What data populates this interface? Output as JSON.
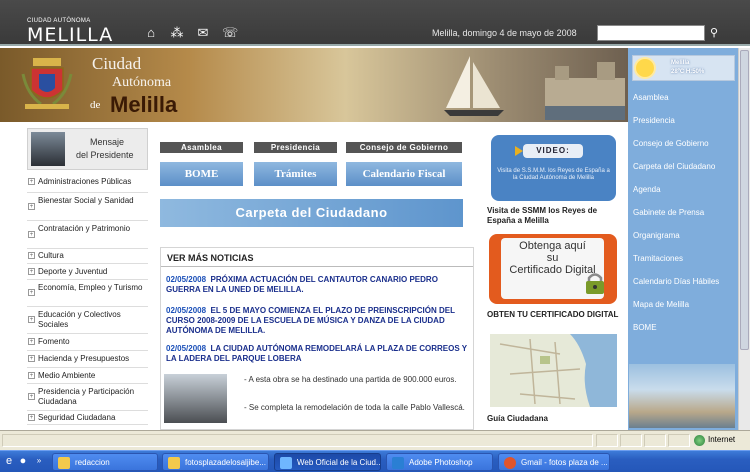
{
  "header": {
    "brand_small": "CIUDAD AUTÓNOMA",
    "brand_big": "MELILLA",
    "icons": [
      "home-icon",
      "sitemap-icon",
      "mail-icon",
      "chat-icon"
    ],
    "date": "Melilla, domingo 4 de mayo de 2008",
    "search_placeholder": ""
  },
  "banner": {
    "line1": "Ciudad",
    "line2": "Autónoma",
    "line3_pre": "de",
    "line3": "Melilla"
  },
  "weather": {
    "city": "Melilla",
    "reading": "28ºC  H:50%"
  },
  "right_menu": [
    "Asamblea",
    "Presidencia",
    "Consejo de Gobierno",
    "Carpeta del Ciudadano",
    "Agenda",
    "Gabinete de Prensa",
    "Organigrama",
    "Tramitaciones",
    "Calendario Días Hábiles",
    "Mapa de Melilla",
    "BOME"
  ],
  "president": {
    "line1": "Mensaje",
    "line2": "del Presidente"
  },
  "left_menu": [
    "Administraciones Públicas",
    "Bienestar Social y Sanidad",
    "Contratación y Patrimonio",
    "Cultura",
    "Deporte y Juventud",
    "Economía, Empleo y Turismo",
    "Educación y Colectivos Sociales",
    "Fomento",
    "Hacienda y Presupuestos",
    "Medio Ambiente",
    "Presidencia y Participación Ciudadana",
    "Seguridad Ciudadana"
  ],
  "tabs": [
    "Asamblea",
    "Presidencia",
    "Consejo de Gobierno"
  ],
  "big_buttons": [
    "BOME",
    "Trámites",
    "Calendario Fiscal"
  ],
  "carpeta": "Carpeta del Ciudadano",
  "news": {
    "header": "VER MÁS NOTICIAS",
    "items": [
      {
        "date": "02/05/2008",
        "title": "PRÓXIMA ACTUACIÓN DEL CANTAUTOR CANARIO PEDRO GUERRA EN LA UNED DE MELILLA."
      },
      {
        "date": "02/05/2008",
        "title": "EL 5 DE MAYO COMIENZA EL PLAZO DE PREINSCRIPCIÓN DEL CURSO 2008-2009 DE LA ESCUELA DE MÚSICA Y DANZA DE LA CIUDAD AUTÓNOMA DE MELILLA."
      },
      {
        "date": "02/05/2008",
        "title": "LA CIUDAD AUTÓNOMA REMODELARÁ LA PLAZA DE CORREOS Y LA LADERA DEL PARQUE LOBERA"
      }
    ],
    "points": [
      "- A esta obra se ha destinado una partida de 900.000 euros.",
      "- Se completa la remodelación de toda la calle Pablo Vallescá."
    ]
  },
  "video": {
    "label": "VIDEO:",
    "desc": "Visita de S.S.M.M. los Reyes de España a la Ciudad Autónoma de Melilla",
    "caption": "Visita de SSMM los Reyes de España a Melilla"
  },
  "cert": {
    "line1": "Obtenga aquí",
    "line2": "su",
    "line3": "Certificado Digital",
    "caption": "OBTEN TU CERTIFICADO DIGITAL"
  },
  "map_caption": "Guía Ciudadana",
  "statusbar": {
    "zone": "Internet"
  },
  "taskbar": {
    "tasks": [
      {
        "label": "redaccion",
        "active": false
      },
      {
        "label": "fotosplazadelosaljibe...",
        "active": false
      },
      {
        "label": "Web Oficial de la Ciud...",
        "active": true
      },
      {
        "label": "Adobe Photoshop",
        "active": false
      },
      {
        "label": "Gmail - fotos plaza de ...",
        "active": false
      }
    ]
  }
}
